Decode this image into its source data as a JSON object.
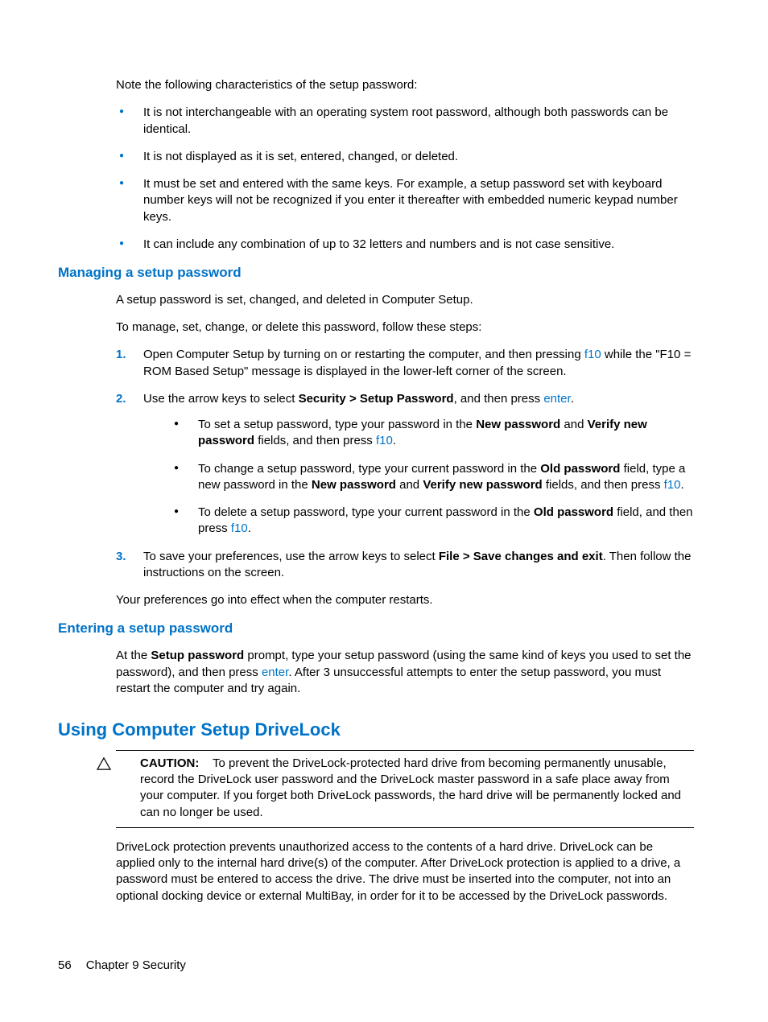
{
  "intro": "Note the following characteristics of the setup password:",
  "characteristics": [
    "It is not interchangeable with an operating system root password, although both passwords can be identical.",
    "It is not displayed as it is set, entered, changed, or deleted.",
    "It must be set and entered with the same keys. For example, a setup password set with keyboard number keys will not be recognized if you enter it thereafter with embedded numeric keypad number keys.",
    "It can include any combination of up to 32 letters and numbers and is not case sensitive."
  ],
  "managing": {
    "heading": "Managing a setup password",
    "p1": "A setup password is set, changed, and deleted in Computer Setup.",
    "p2": "To manage, set, change, or delete this password, follow these steps:",
    "step1_a": "Open Computer Setup by turning on or restarting the computer, and then pressing ",
    "step1_key": "f10",
    "step1_b": " while the \"F10 = ROM Based Setup\" message is displayed in the lower-left corner of the screen.",
    "step2_a": "Use the arrow keys to select ",
    "step2_bold": "Security > Setup Password",
    "step2_b": ", and then press ",
    "step2_key": "enter",
    "step2_c": ".",
    "sub1_a": "To set a setup password, type your password in the ",
    "sub1_b1": "New password",
    "sub1_c": " and ",
    "sub1_b2": "Verify new password",
    "sub1_d": " fields, and then press ",
    "sub1_key": "f10",
    "sub1_e": ".",
    "sub2_a": "To change a setup password, type your current password in the ",
    "sub2_b1": "Old password",
    "sub2_b": " field, type a new password in the ",
    "sub2_b2": "New password",
    "sub2_c": " and ",
    "sub2_b3": "Verify new password",
    "sub2_d": " fields, and then press ",
    "sub2_key": "f10",
    "sub2_e": ".",
    "sub3_a": "To delete a setup password, type your current password in the ",
    "sub3_b1": "Old password",
    "sub3_b": " field, and then press ",
    "sub3_key": "f10",
    "sub3_c": ".",
    "step3_a": "To save your preferences, use the arrow keys to select ",
    "step3_bold": "File > Save changes and exit",
    "step3_b": ". Then follow the instructions on the screen.",
    "closing": "Your preferences go into effect when the computer restarts."
  },
  "entering": {
    "heading": "Entering a setup password",
    "a": "At the ",
    "bold": "Setup password",
    "b": " prompt, type your setup password (using the same kind of keys you used to set the password), and then press ",
    "key": "enter",
    "c": ". After 3 unsuccessful attempts to enter the setup password, you must restart the computer and try again."
  },
  "drivelock": {
    "heading": "Using Computer Setup DriveLock",
    "caution_label": "CAUTION:",
    "caution_text": "To prevent the DriveLock-protected hard drive from becoming permanently unusable, record the DriveLock user password and the DriveLock master password in a safe place away from your computer. If you forget both DriveLock passwords, the hard drive will be permanently locked and can no longer be used.",
    "body": "DriveLock protection prevents unauthorized access to the contents of a hard drive. DriveLock can be applied only to the internal hard drive(s) of the computer. After DriveLock protection is applied to a drive, a password must be entered to access the drive. The drive must be inserted into the computer, not into an optional docking device or external MultiBay, in order for it to be accessed by the DriveLock passwords."
  },
  "footer": {
    "page": "56",
    "chapter": "Chapter 9   Security"
  }
}
